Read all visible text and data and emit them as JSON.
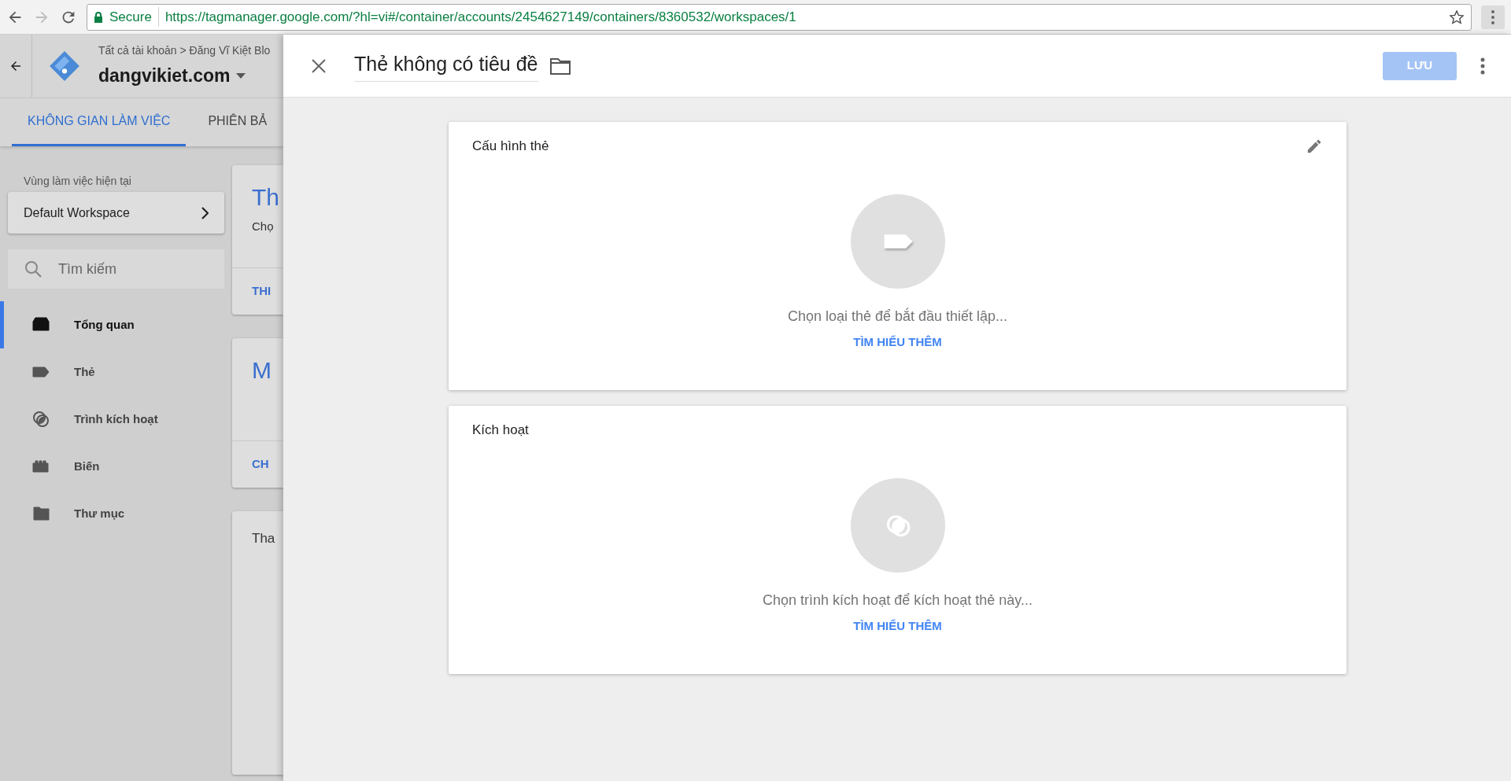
{
  "browser": {
    "secure_label": "Secure",
    "url": "https://tagmanager.google.com/?hl=vi#/container/accounts/2454627149/containers/8360532/workspaces/1"
  },
  "app": {
    "breadcrumb": "Tất cả tài khoản > Đăng Vĩ Kiệt Blo",
    "container": "dangvikiet.com",
    "tabs": [
      {
        "label": "KHÔNG GIAN LÀM VIỆC",
        "selected": true
      },
      {
        "label": "PHIÊN BẢ",
        "selected": false
      }
    ],
    "workspace_label": "Vùng làm việc hiện tại",
    "workspace": "Default Workspace",
    "search": {
      "placeholder": "Tìm kiếm"
    },
    "nav": [
      {
        "label": "Tổng quan",
        "kind": "overview",
        "selected": true
      },
      {
        "label": "Thẻ",
        "kind": "tag",
        "selected": false
      },
      {
        "label": "Trình kích hoạt",
        "kind": "trigger",
        "selected": false
      },
      {
        "label": "Biến",
        "kind": "variable",
        "selected": false
      },
      {
        "label": "Thư mục",
        "kind": "folder",
        "selected": false
      }
    ],
    "cards": [
      {
        "title": "Th",
        "text": "Chọ",
        "link": "THI"
      },
      {
        "title": "M",
        "link": "CH"
      },
      {
        "text": "Tha"
      }
    ]
  },
  "panel": {
    "title": "Thẻ không có tiêu đề",
    "save": "LƯU",
    "sections": [
      {
        "title": "Cấu hình thẻ",
        "kind": "tag",
        "editable": true,
        "hint": "Chọn loại thẻ để bắt đầu thiết lập...",
        "link": "TÌM HIỂU THÊM"
      },
      {
        "title": "Kích hoạt",
        "kind": "trigger",
        "editable": false,
        "hint": "Chọn trình kích hoạt để kích hoạt thẻ này...",
        "link": "TÌM HIỂU THÊM"
      }
    ]
  }
}
